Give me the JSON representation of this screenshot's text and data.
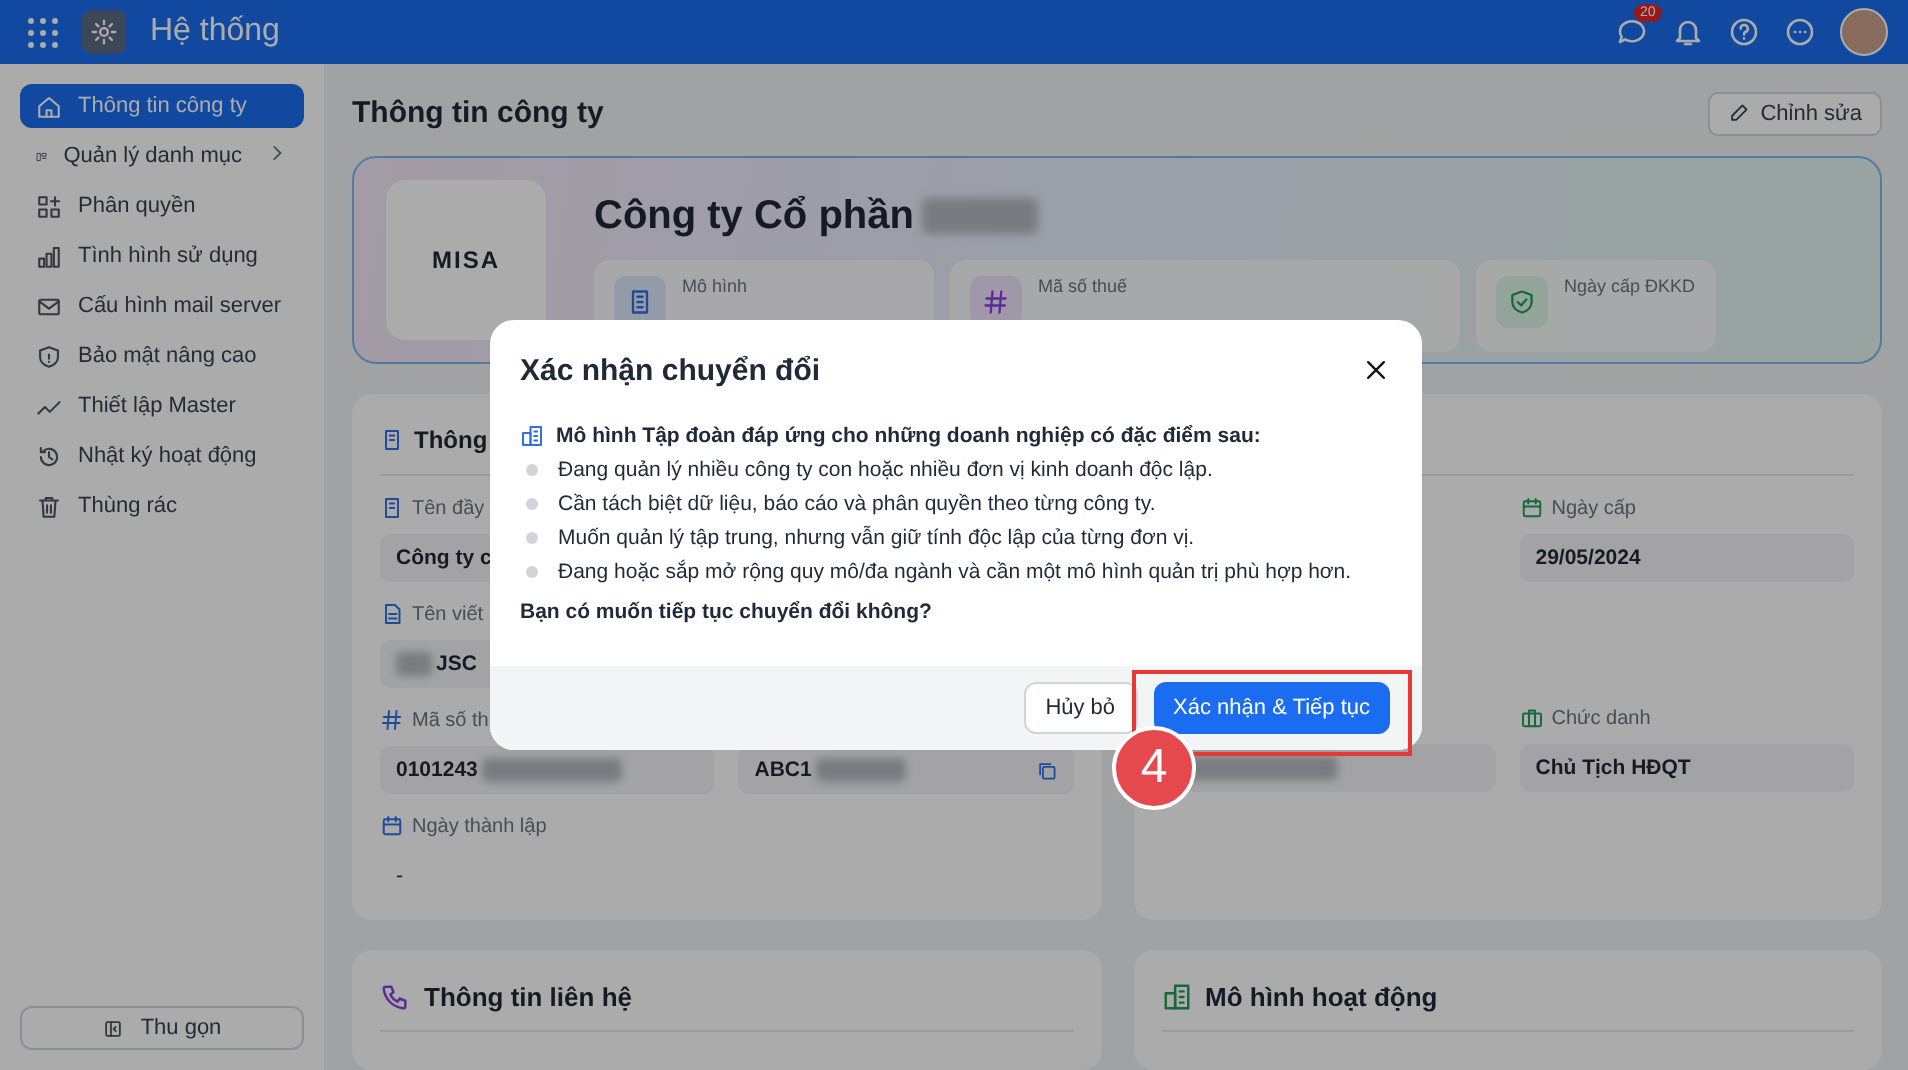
{
  "topbar": {
    "title": "Hệ thống",
    "chat_badge": "20"
  },
  "sidebar": {
    "items": [
      {
        "label": "Thông tin công ty",
        "selected": true,
        "has_submenu": false
      },
      {
        "label": "Quản lý danh mục",
        "selected": false,
        "has_submenu": true
      },
      {
        "label": "Phân quyền",
        "selected": false,
        "has_submenu": false
      },
      {
        "label": "Tình hình sử dụng",
        "selected": false,
        "has_submenu": false
      },
      {
        "label": "Cấu hình mail server",
        "selected": false,
        "has_submenu": false
      },
      {
        "label": "Bảo mật nâng cao",
        "selected": false,
        "has_submenu": false
      },
      {
        "label": "Thiết lập Master",
        "selected": false,
        "has_submenu": false
      },
      {
        "label": "Nhật ký hoạt động",
        "selected": false,
        "has_submenu": false
      },
      {
        "label": "Thùng rác",
        "selected": false,
        "has_submenu": false
      }
    ],
    "collapse_button": "Thu gọn"
  },
  "page": {
    "title": "Thông tin công ty",
    "edit_button": "Chỉnh sửa"
  },
  "company": {
    "logo_text": "MISA",
    "name": "Công ty Cổ phần",
    "stats": [
      {
        "label": "Mô hình"
      },
      {
        "label": "Mã số thuế"
      },
      {
        "label": "Ngày cấp ĐKKD"
      }
    ]
  },
  "general_card": {
    "title": "Thông",
    "rows": [
      {
        "label": "Tên đầy",
        "value": "Công ty c"
      },
      {
        "label": "Tên viết",
        "value": "JSC"
      },
      {
        "label": "Mã số th",
        "value": "0101243",
        "value_2": "ABC1"
      },
      {
        "label": "Ngày thành lập",
        "value": "-"
      }
    ]
  },
  "person_card": {
    "rows": [
      {
        "label": "Ngày cấp",
        "value": "29/05/2024"
      },
      {
        "label": "Chức danh",
        "value": "Chủ Tịch HĐQT"
      }
    ]
  },
  "bottom_cards": [
    {
      "title": "Thông tin liên hệ"
    },
    {
      "title": "Mô hình hoạt động"
    }
  ],
  "dialog": {
    "title": "Xác nhận chuyển đổi",
    "heading": "Mô hình Tập đoàn đáp ứng cho những doanh nghiệp có đặc điểm sau:",
    "bullets": [
      "Đang quản lý nhiều công ty con hoặc nhiều đơn vị kinh doanh độc lập.",
      "Cần tách biệt dữ liệu, báo cáo và phân quyền theo từng công ty.",
      "Muốn quản lý tập trung, nhưng vẫn giữ tính độc lập của từng đơn vị.",
      "Đang hoặc sắp mở rộng quy mô/đa ngành và cần một mô hình quản trị phù hợp hơn."
    ],
    "question": "Bạn có muốn tiếp tục chuyển đổi không?",
    "cancel_button": "Hủy bỏ",
    "confirm_button": "Xác nhận & Tiếp tục"
  },
  "step_badge": "4"
}
